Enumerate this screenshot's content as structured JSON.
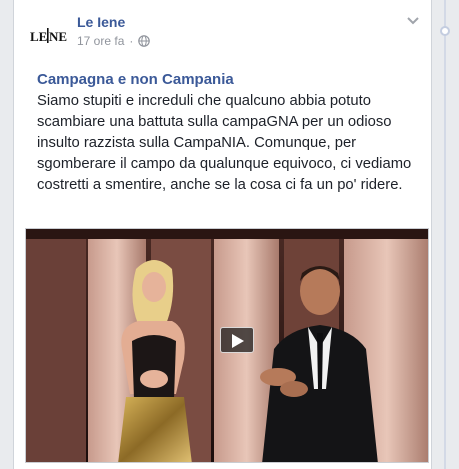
{
  "post": {
    "page_name": "Le Iene",
    "timestamp": "17 ore fa",
    "title": "Campagna e non Campania",
    "body": "Siamo stupiti e increduli che qualcuno abbia potuto scambiare una battuta sulla campaGNA per un odioso insulto razzista sulla CampaNIA. Comunque, per sgomberare il campo da qualunque equivoco, ci vediamo costretti a smentire, anche se la cosa ci fa un po' ridere.",
    "logo_text": "LE IENE"
  },
  "icons": {
    "privacy": "globe-icon",
    "menu": "chevron-down-icon",
    "play": "play-icon"
  },
  "colors": {
    "link_blue": "#3b5998",
    "meta_gray": "#90949c",
    "text": "#1d2129",
    "background": "#e9ebee"
  }
}
